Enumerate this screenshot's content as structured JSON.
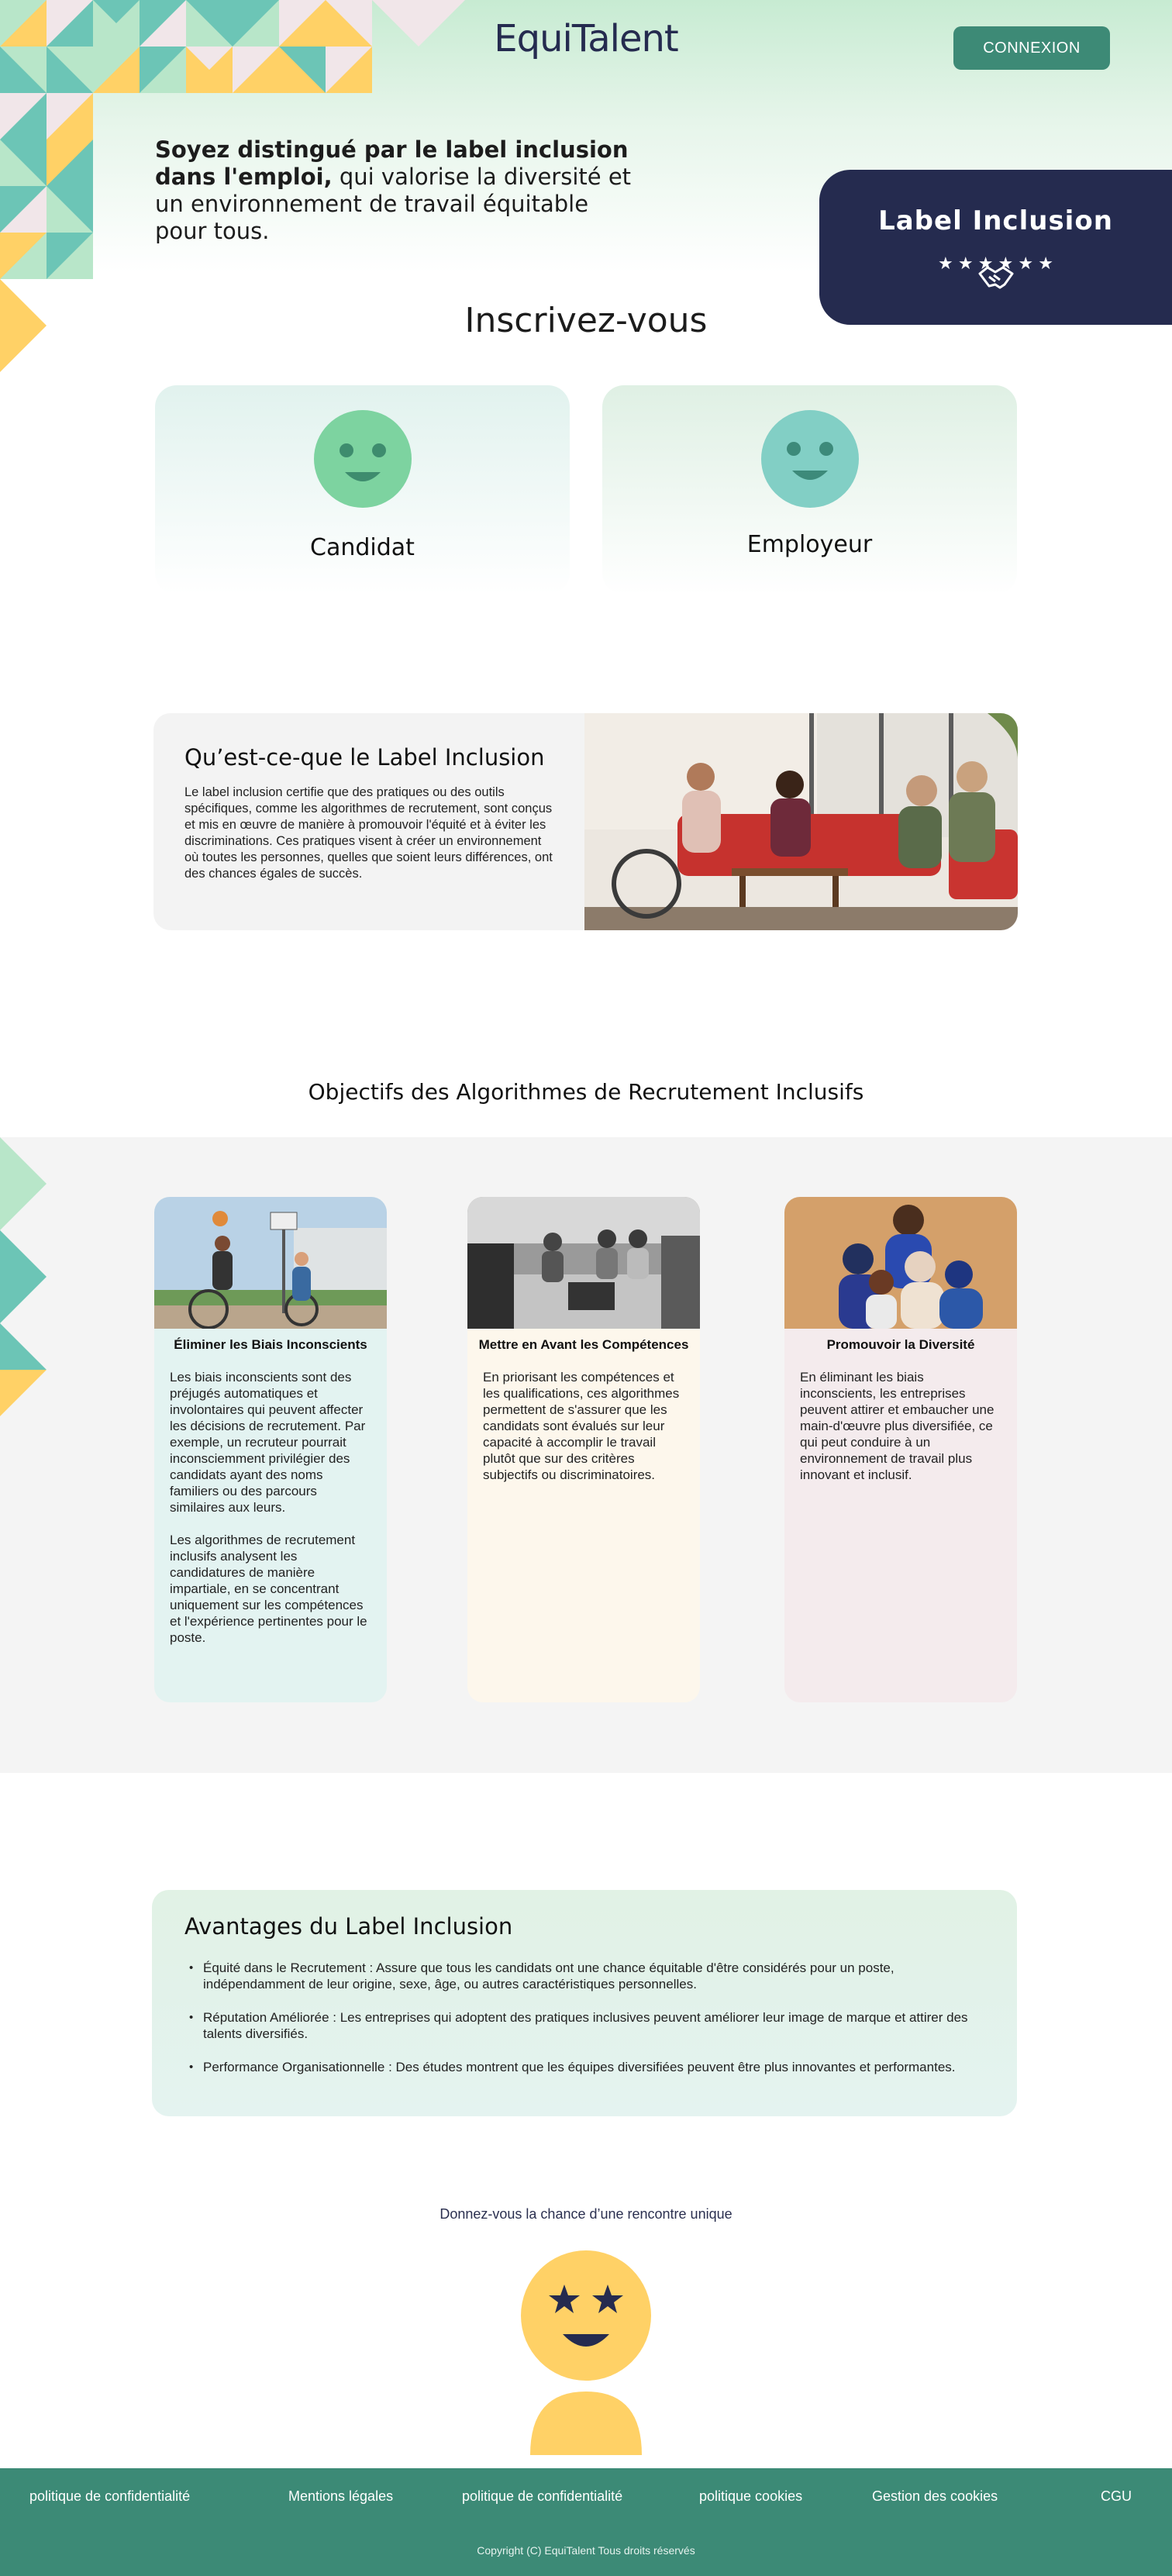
{
  "header": {
    "logo_text": "EquiTalent",
    "login_button": "CONNEXION"
  },
  "hero": {
    "intro_bold": "Soyez distingué par le label inclusion dans l'emploi,",
    "intro_rest": " qui valorise la diversité et un environnement de travail équitable pour tous.",
    "label_card_title": "Label Inclusion",
    "label_card_stars": "★ ★ ★                    ★ ★ ★"
  },
  "signup": {
    "title": "Inscrivez-vous",
    "candidate_label": "Candidat",
    "employer_label": "Employeur"
  },
  "what_is": {
    "title": "Qu’est-ce-que le Label Inclusion",
    "text": "Le label inclusion certifie que des pratiques ou des outils spécifiques, comme les algorithmes de recrutement, sont conçus et mis en œuvre de manière à promouvoir l'équité et à éviter les discriminations. Ces pratiques visent à créer un environnement où toutes les personnes, quelles que soient leurs différences, ont des chances égales de succès."
  },
  "objectives": {
    "title": "Objectifs des Algorithmes de Recrutement Inclusifs",
    "cards": [
      {
        "title": "Éliminer les Biais Inconscients",
        "paragraphs": [
          "Les biais inconscients sont des préjugés automatiques et involontaires qui peuvent affecter les décisions de recrutement. Par exemple, un recruteur pourrait inconsciemment privilégier des candidats ayant des noms familiers ou des parcours similaires aux leurs.",
          "Les algorithmes de recrutement inclusifs analysent les candidatures de manière impartiale, en se concentrant uniquement sur les compétences et l'expérience pertinentes pour le poste."
        ]
      },
      {
        "title": "Mettre en Avant les Compétences",
        "paragraphs": [
          "En priorisant les compétences et les qualifications, ces algorithmes permettent de s'assurer que les candidats sont évalués sur leur capacité à accomplir le travail plutôt que sur des critères subjectifs ou discriminatoires."
        ]
      },
      {
        "title": "Promouvoir la Diversité",
        "paragraphs": [
          "En éliminant les biais inconscients, les entreprises peuvent attirer et embaucher une main-d'œuvre plus diversifiée, ce qui peut conduire à un environnement de travail plus innovant et inclusif."
        ]
      }
    ]
  },
  "advantages": {
    "title": "Avantages du Label Inclusion",
    "items": [
      "Équité dans le Recrutement : Assure que tous les candidats ont une chance équitable d'être considérés pour un poste, indépendamment de leur origine, sexe, âge, ou autres caractéristiques personnelles.",
      "Réputation Améliorée : Les entreprises qui adoptent des pratiques inclusives peuvent améliorer leur image de marque et attirer des talents diversifiés.",
      "Performance Organisationnelle : Des études montrent que les équipes diversifiées peuvent être plus innovantes et performantes."
    ]
  },
  "cta": {
    "text": "Donnez-vous la chance d’une rencontre unique"
  },
  "footer": {
    "links": [
      "politique de confidentialité",
      "Mentions légales",
      "politique de confidentialité",
      "politique cookies",
      "Gestion des cookies",
      "CGU"
    ],
    "copyright": "Copyright (C) EquiTalent Tous droits réservés"
  },
  "colors": {
    "navy": "#252b4f",
    "green": "#3c8a76",
    "mint": "#7dd3a0",
    "teal": "#82cfc5",
    "yellow": "#ffd166"
  }
}
